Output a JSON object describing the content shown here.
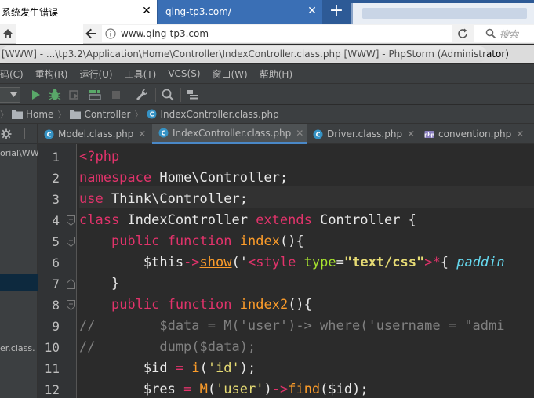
{
  "browser": {
    "tabs": [
      {
        "title": "系统发生错误",
        "active": true
      },
      {
        "title": "qing-tp3.com/",
        "active": false
      }
    ],
    "new_tab_symbol": "+",
    "url": "www.qing-tp3.com",
    "search_placeholder": "搜索"
  },
  "ide": {
    "title": "[WWW] - ...\\tp3.2\\Application\\Home\\Controller\\IndexController.class.php [WWW] - PhpStorm (Administrator)",
    "menu": [
      "码(C)",
      "重构(R)",
      "运行(U)",
      "工具(T)",
      "VCS(S)",
      "窗口(W)",
      "帮助(H)"
    ],
    "breadcrumb": [
      "Home",
      "Controller",
      "IndexController.class.php"
    ],
    "project_panel": {
      "row1": "orial\\WW",
      "row2": "er.class."
    },
    "editor_tabs": [
      {
        "label": "Model.class.php",
        "active": false
      },
      {
        "label": "IndexController.class.php",
        "active": true
      },
      {
        "label": "Driver.class.php",
        "active": false
      },
      {
        "label": "convention.php",
        "active": false
      }
    ],
    "line_numbers": [
      "1",
      "2",
      "3",
      "4",
      "5",
      "6",
      "7",
      "8",
      "9",
      "10",
      "11",
      "12"
    ]
  },
  "colors": {
    "keyword": "#e2336b",
    "function": "#fc9c2a",
    "string": "#e6db74",
    "comment": "#808080",
    "attribute": "#a6e22e",
    "accent": "#4a88c7"
  }
}
